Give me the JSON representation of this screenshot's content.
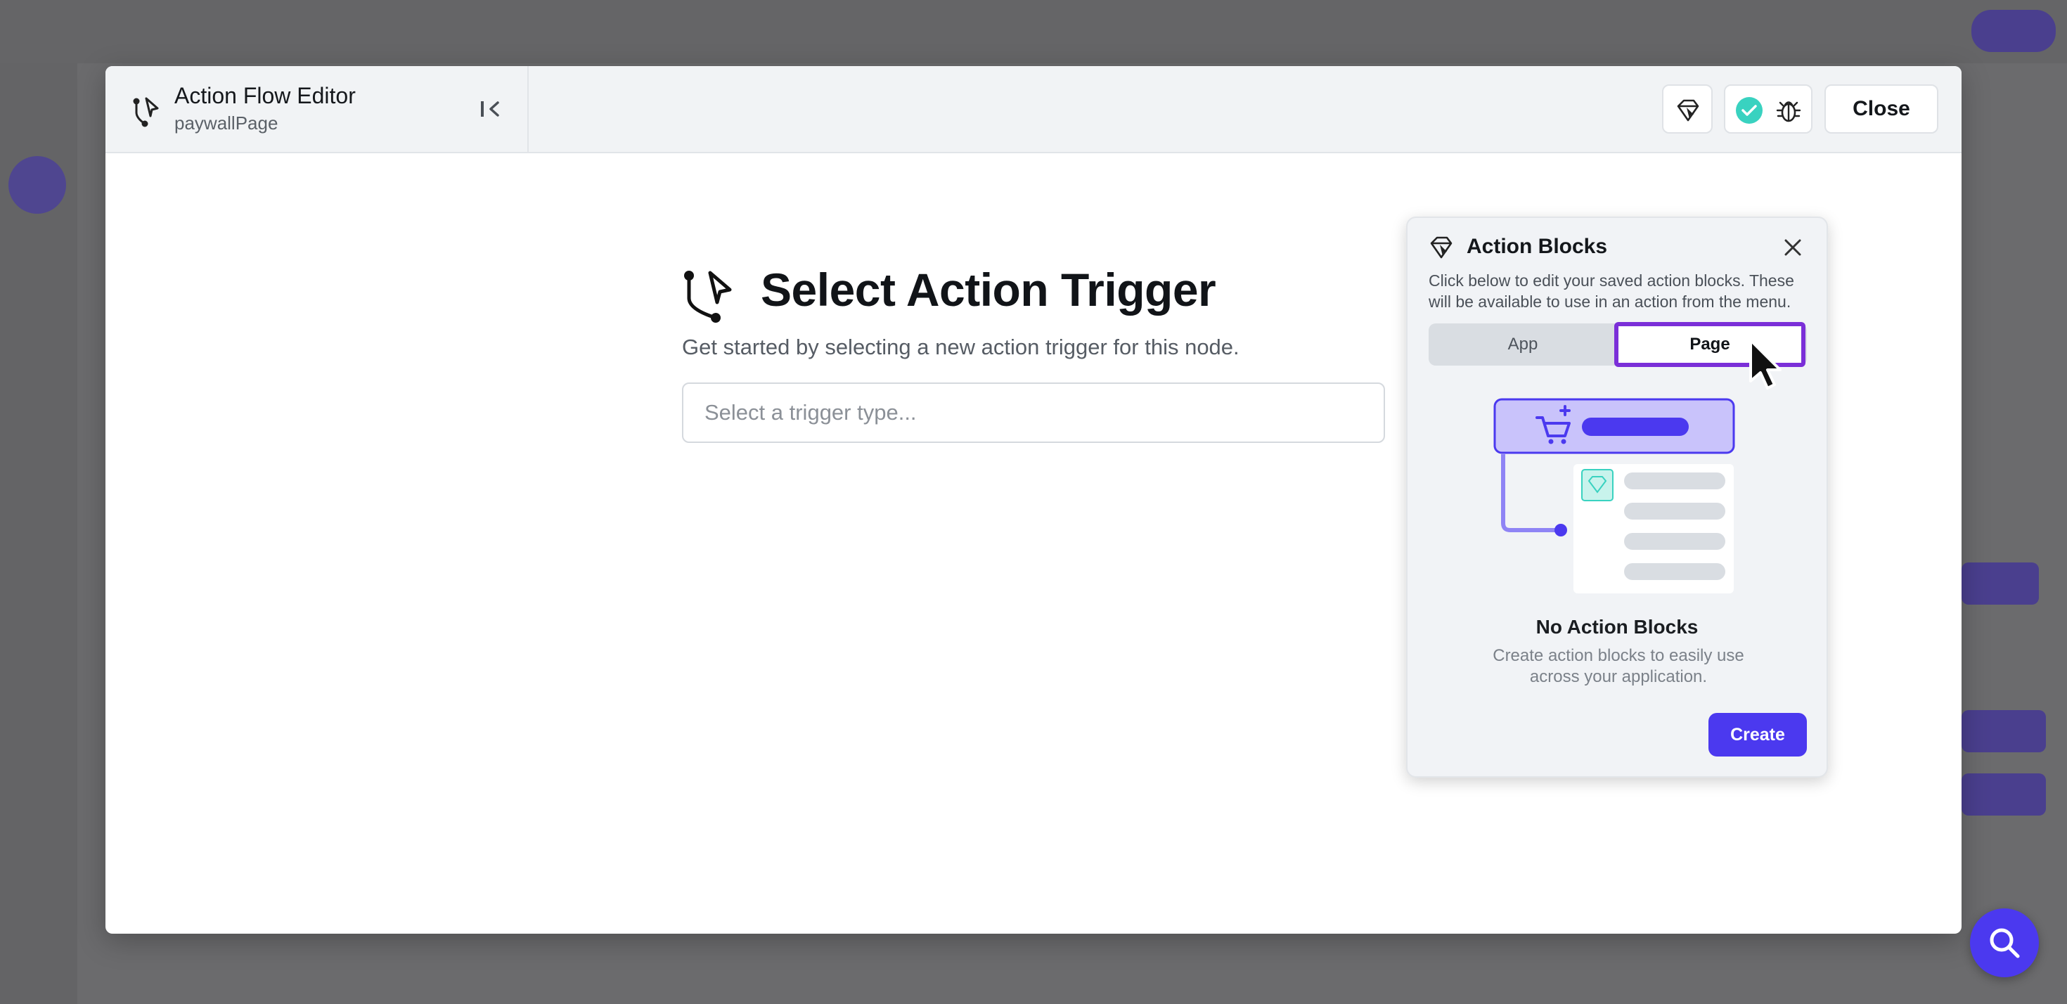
{
  "colors": {
    "primary": "#4b39ef",
    "highlight_outline": "#7b2fd8",
    "success": "#39d2c0",
    "overlay": "#6b6b6d"
  },
  "modal": {
    "title": "Action Flow Editor",
    "subtitle": "paywallPage",
    "close_label": "Close",
    "icons": {
      "flow": "action-flow-icon",
      "collapse": "collapse-panel-icon",
      "action_blocks": "action-blocks-icon",
      "valid": "check-circle-icon",
      "debug": "bug-icon"
    }
  },
  "main": {
    "title": "Select Action Trigger",
    "description": "Get started by selecting a new action trigger for this node.",
    "trigger_input": {
      "placeholder": "Select a trigger type...",
      "value": ""
    }
  },
  "popover": {
    "title": "Action Blocks",
    "description": "Click below to edit your saved action blocks. These will be available to use in an action from the menu.",
    "tabs": [
      {
        "label": "App",
        "selected": false
      },
      {
        "label": "Page",
        "selected": true
      }
    ],
    "empty_title": "No Action Blocks",
    "empty_description": "Create action blocks to easily use across your application.",
    "create_label": "Create"
  },
  "fab": {
    "icon": "search-icon"
  }
}
